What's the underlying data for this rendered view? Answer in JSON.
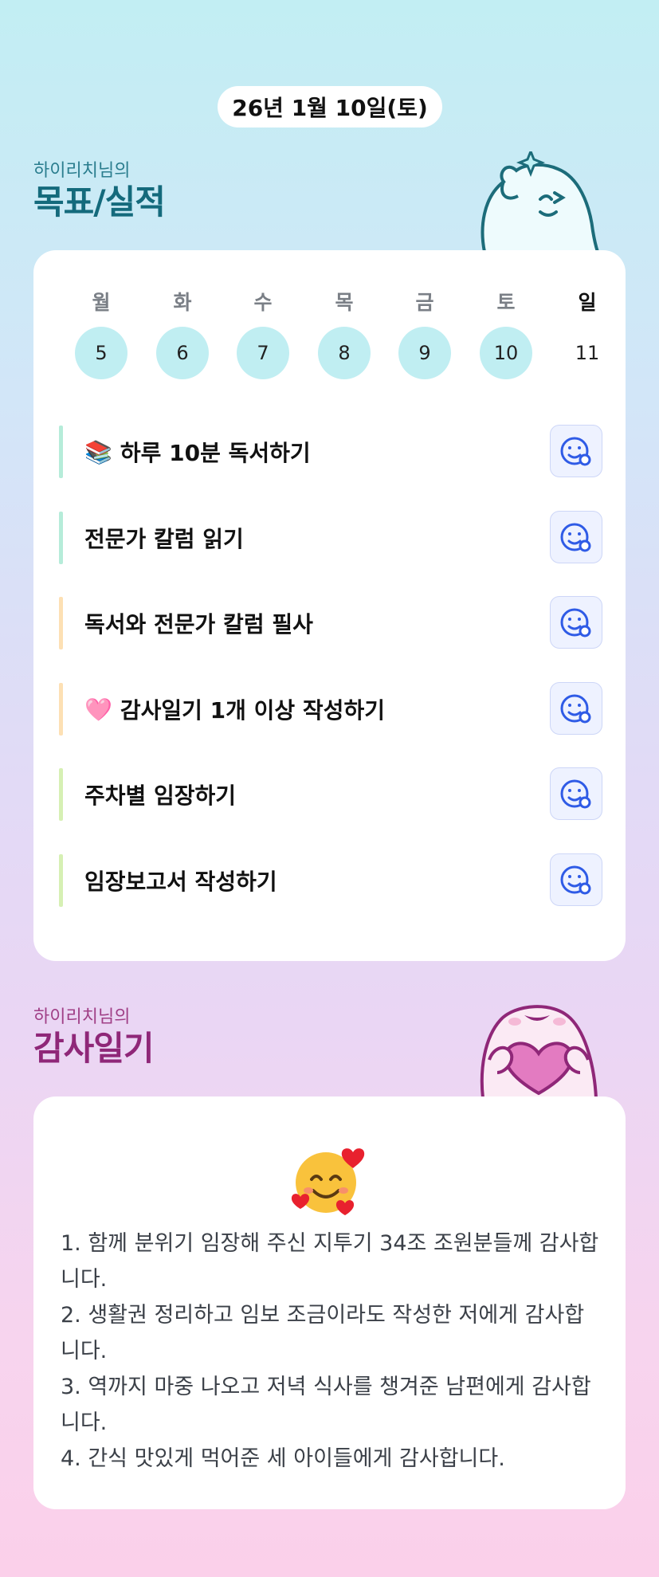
{
  "date": "26년 1월 10일(토)",
  "goals_section": {
    "owner": "하이리치님의",
    "title": "목표/실적"
  },
  "week": [
    {
      "day": "월",
      "num": "5",
      "done": true
    },
    {
      "day": "화",
      "num": "6",
      "done": true
    },
    {
      "day": "수",
      "num": "7",
      "done": true
    },
    {
      "day": "목",
      "num": "8",
      "done": true
    },
    {
      "day": "금",
      "num": "9",
      "done": true
    },
    {
      "day": "토",
      "num": "10",
      "done": true
    },
    {
      "day": "일",
      "num": "11",
      "done": false
    }
  ],
  "tasks": [
    {
      "emoji": "📚",
      "label": "하루 10분 독서하기",
      "bar_color": "#b6ecd9"
    },
    {
      "emoji": "",
      "label": "전문가 칼럼 읽기",
      "bar_color": "#b6ecd9"
    },
    {
      "emoji": "",
      "label": "독서와 전문가 칼럼 필사",
      "bar_color": "#fde0b4"
    },
    {
      "emoji": "🩷",
      "label": "감사일기 1개 이상 작성하기",
      "bar_color": "#fde0b4"
    },
    {
      "emoji": "",
      "label": "주차별 임장하기",
      "bar_color": "#d6f0b4"
    },
    {
      "emoji": "",
      "label": "임장보고서 작성하기",
      "bar_color": "#d6f0b4"
    }
  ],
  "gratitude_section": {
    "owner": "하이리치님의",
    "title": "감사일기"
  },
  "gratitude_lines": [
    "1. 함께 분위기 임장해 주신 지투기 34조 조원분들께 감사합니다.",
    "2. 생활권 정리하고 임보 조금이라도 작성한 저에게 감사합니다.",
    "3. 역까지 마중 나오고 저녁 식사를 챙겨준 남편에게 감사합니다.",
    "4. 간식 맛있게 먹어준 세 아이들에게 감사합니다."
  ],
  "colors": {
    "accent": "#2f5be6",
    "goal_title": "#146a7c",
    "gratitude_title": "#8f2778",
    "done_day": "#c0eef2"
  }
}
